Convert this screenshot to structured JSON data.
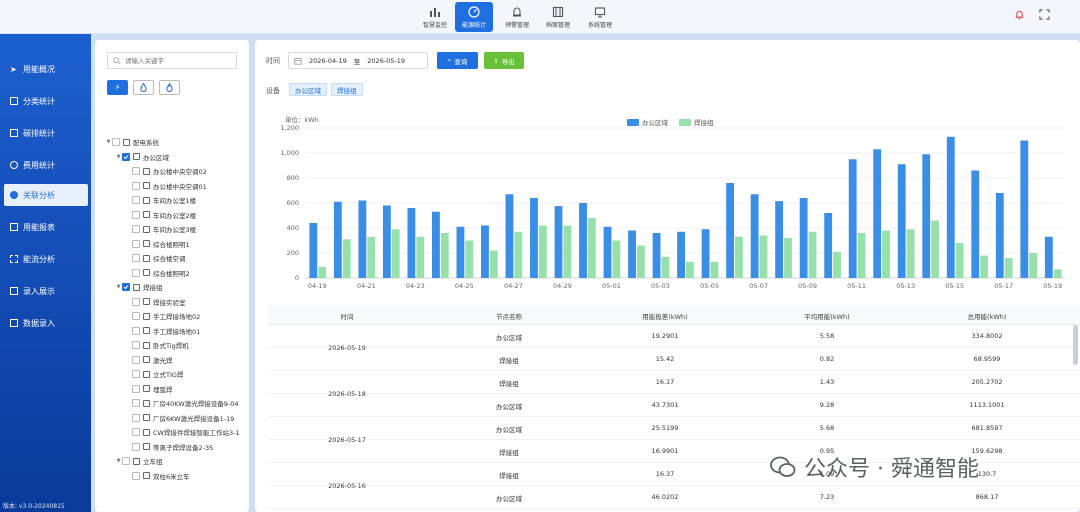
{
  "top_nav": [
    {
      "label": "智慧监控",
      "icon": "bar-chart-icon"
    },
    {
      "label": "能源统计",
      "icon": "gauge-icon",
      "active": true
    },
    {
      "label": "预警管理",
      "icon": "alarm-icon"
    },
    {
      "label": "档案管理",
      "icon": "archive-icon"
    },
    {
      "label": "系统管理",
      "icon": "monitor-icon"
    }
  ],
  "sidebar": {
    "items": [
      {
        "label": "用能概况",
        "icon": "send-icon"
      },
      {
        "label": "分类统计",
        "icon": "category-icon"
      },
      {
        "label": "碳排统计",
        "icon": "carbon-icon"
      },
      {
        "label": "费用统计",
        "icon": "cost-icon"
      },
      {
        "label": "关联分析",
        "icon": "link-icon",
        "active": true
      },
      {
        "label": "用能报表",
        "icon": "report-icon"
      },
      {
        "label": "能流分析",
        "icon": "flow-icon"
      },
      {
        "label": "录入展示",
        "icon": "entry-icon"
      },
      {
        "label": "数据录入",
        "icon": "data-entry-icon"
      }
    ],
    "version": "版本: v3.0-20240815"
  },
  "tree_panel": {
    "search_placeholder": "请输入关键字",
    "energy_types": [
      "electricity-icon",
      "water-drop-icon",
      "flame-icon"
    ],
    "nodes": [
      {
        "label": "配电系统",
        "level": 0,
        "expand": true,
        "checked": false
      },
      {
        "label": "办公区域",
        "level": 1,
        "expand": true,
        "checked": true
      },
      {
        "label": "办公楼中央空调02",
        "level": 2,
        "checked": false
      },
      {
        "label": "办公楼中央空调01",
        "level": 2,
        "checked": false
      },
      {
        "label": "车间办公室1楼",
        "level": 2,
        "checked": false
      },
      {
        "label": "车间办公室2楼",
        "level": 2,
        "checked": false
      },
      {
        "label": "车间办公室3楼",
        "level": 2,
        "checked": false
      },
      {
        "label": "综合楼照明1",
        "level": 2,
        "checked": false
      },
      {
        "label": "综合楼空调",
        "level": 2,
        "checked": false
      },
      {
        "label": "综合楼照明2",
        "level": 2,
        "checked": false
      },
      {
        "label": "焊接组",
        "level": 1,
        "expand": true,
        "checked": true
      },
      {
        "label": "焊接实验室",
        "level": 2,
        "checked": false
      },
      {
        "label": "手工焊接场地02",
        "level": 2,
        "checked": false
      },
      {
        "label": "手工焊接场地01",
        "level": 2,
        "checked": false
      },
      {
        "label": "卧式Tig焊机",
        "level": 2,
        "checked": false
      },
      {
        "label": "激光焊",
        "level": 2,
        "checked": false
      },
      {
        "label": "立式TIG焊",
        "level": 2,
        "checked": false
      },
      {
        "label": "埋弧焊",
        "level": 2,
        "checked": false
      },
      {
        "label": "厂房40KW激光焊接设备9-04",
        "level": 2,
        "checked": false
      },
      {
        "label": "厂房6KW激光焊接设备1-19",
        "level": 2,
        "checked": false
      },
      {
        "label": "CW焊接件焊接智能工作站3-1",
        "level": 2,
        "checked": false
      },
      {
        "label": "等离子焊焊设备2-35",
        "level": 2,
        "checked": false
      },
      {
        "label": "立车组",
        "level": 1,
        "expand": true,
        "checked": false
      },
      {
        "label": "双柱6米立车",
        "level": 2,
        "checked": false
      }
    ]
  },
  "filters": {
    "time_label": "时间",
    "start_date": "2026-04-19",
    "range_sep": "至",
    "end_date": "2026-05-19",
    "query_label": "查询",
    "export_label": "导出",
    "device_label": "设备",
    "device_tags": [
      "办公区域",
      "焊接组"
    ]
  },
  "chart_data": {
    "type": "bar",
    "unit_label": "单位：kWh",
    "categories": [
      "04-19",
      "04-20",
      "04-21",
      "04-22",
      "04-23",
      "04-24",
      "04-25",
      "04-26",
      "04-27",
      "04-28",
      "04-29",
      "04-30",
      "05-01",
      "05-02",
      "05-03",
      "05-04",
      "05-05",
      "05-06",
      "05-07",
      "05-08",
      "05-09",
      "05-10",
      "05-11",
      "05-12",
      "05-13",
      "05-14",
      "05-15",
      "05-16",
      "05-17",
      "05-18",
      "05-19"
    ],
    "x_tick_labels": [
      "04-19",
      "04-21",
      "04-23",
      "04-25",
      "04-27",
      "04-29",
      "05-01",
      "05-03",
      "05-05",
      "05-07",
      "05-09",
      "05-11",
      "05-13",
      "05-15",
      "05-17",
      "05-19"
    ],
    "y_ticks": [
      "0",
      "200",
      "400",
      "600",
      "800",
      "1,000",
      "1,200"
    ],
    "ylim": [
      0,
      1200
    ],
    "legend_position": "top-center",
    "series": [
      {
        "name": "办公区域",
        "color": "#3a8ee6",
        "values": [
          440,
          610,
          620,
          580,
          560,
          530,
          410,
          420,
          670,
          640,
          575,
          600,
          410,
          380,
          360,
          370,
          390,
          760,
          670,
          615,
          640,
          520,
          950,
          1030,
          910,
          990,
          1130,
          860,
          680,
          1100,
          330
        ]
      },
      {
        "name": "焊接组",
        "color": "#98e0ab",
        "values": [
          90,
          310,
          330,
          390,
          330,
          360,
          300,
          220,
          370,
          420,
          420,
          480,
          300,
          260,
          170,
          130,
          130,
          330,
          340,
          320,
          370,
          210,
          360,
          380,
          390,
          460,
          280,
          180,
          160,
          200,
          70
        ]
      }
    ]
  },
  "table": {
    "headers": [
      "时间",
      "节点名称",
      "用能极差(kWh)",
      "平均用能(kWh)",
      "总用能(kWh)"
    ],
    "rows": [
      {
        "time": "2026-05-19",
        "node": "办公区域",
        "range": "19.2901",
        "avg": "5.58",
        "total": "334.8002"
      },
      {
        "time": "",
        "node": "焊接组",
        "range": "15.42",
        "avg": "0.82",
        "total": "68.9599"
      },
      {
        "time": "2026-05-18",
        "node": "焊接组",
        "range": "16.17",
        "avg": "1.43",
        "total": "205.2702"
      },
      {
        "time": "",
        "node": "办公区域",
        "range": "43.7301",
        "avg": "9.28",
        "total": "1113.1001"
      },
      {
        "time": "2026-05-17",
        "node": "办公区域",
        "range": "25.5199",
        "avg": "5.68",
        "total": "681.8597"
      },
      {
        "time": "",
        "node": "焊接组",
        "range": "16.9901",
        "avg": "0.95",
        "total": "159.6298"
      },
      {
        "time": "2026-05-16",
        "node": "焊接组",
        "range": "16.37",
        "avg": "1.09",
        "total": "130.7"
      },
      {
        "time": "",
        "node": "办公区域",
        "range": "46.0202",
        "avg": "7.23",
        "total": "868.17"
      }
    ]
  },
  "watermark": "公众号 · 舜通智能"
}
